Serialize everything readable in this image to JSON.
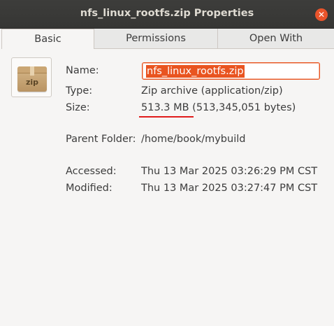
{
  "window": {
    "title": "nfs_linux_rootfs.zip Properties"
  },
  "tabs": [
    "Basic",
    "Permissions",
    "Open With"
  ],
  "file_icon": {
    "label": "zip",
    "icon": "zip-archive-icon"
  },
  "fields": {
    "name_label": "Name:",
    "name_value": "nfs_linux_rootfs.zip",
    "type_label": "Type:",
    "type_value": "Zip archive (application/zip)",
    "size_label": "Size:",
    "size_value": "513.3 MB (513,345,051 bytes)",
    "parent_label": "Parent Folder:",
    "parent_value": "/home/book/mybuild",
    "accessed_label": "Accessed:",
    "accessed_value": "Thu 13 Mar 2025 03:26:29 PM CST",
    "modified_label": "Modified:",
    "modified_value": "Thu 13 Mar 2025 03:27:47 PM CST"
  },
  "colors": {
    "accent": "#e95420",
    "annotation": "#e01b1b",
    "titlebar": "#3a3a38"
  }
}
